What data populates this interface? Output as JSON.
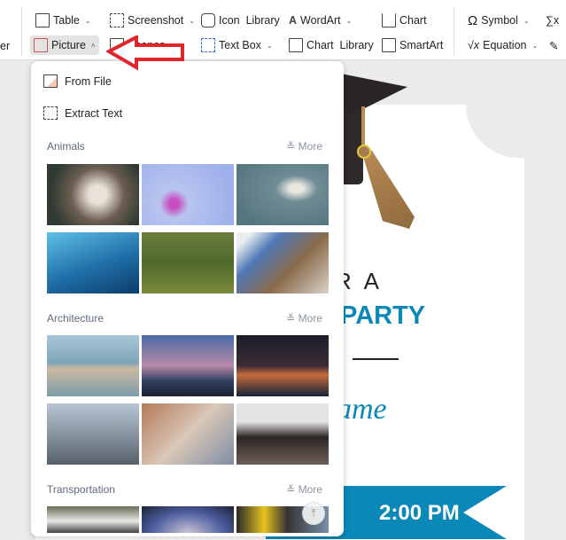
{
  "ribbon": {
    "left_cut": "er",
    "row1": [
      {
        "label": "Table",
        "icon": "table-icon"
      },
      {
        "label": "Screenshot",
        "icon": "screenshot-icon"
      },
      {
        "label": "Icon  Library",
        "icon": "icon-library-icon"
      },
      {
        "label": "WordArt",
        "icon": "wordart-icon"
      },
      {
        "label": "Chart",
        "icon": "chart-icon"
      },
      {
        "label": "Symbol",
        "icon": "omega-icon"
      }
    ],
    "row2": [
      {
        "label": "Picture",
        "icon": "picture-icon"
      },
      {
        "label": "Shapes",
        "icon": "shapes-icon"
      },
      {
        "label": "Text Box",
        "icon": "textbox-icon"
      },
      {
        "label": "Chart  Library",
        "icon": "chart-library-icon"
      },
      {
        "label": "SmartArt",
        "icon": "smartart-icon"
      },
      {
        "label": "Equation",
        "icon": "equation-icon"
      }
    ],
    "symbol_glyph": "Ω",
    "equation_glyph": "√x",
    "sigma_glyph": "∑x",
    "accent": "#e0262b"
  },
  "panel": {
    "from_file": "From File",
    "extract_text": "Extract Text",
    "more": "More",
    "more_glyph": "≚",
    "sections": [
      {
        "title": "Animals"
      },
      {
        "title": "Architecture"
      },
      {
        "title": "Transportation"
      }
    ],
    "totop_glyph": "⤒"
  },
  "document": {
    "line1": "R A",
    "line2": "PARTY",
    "name": "ame",
    "time": "2:00 PM",
    "accent": "#0a88b8"
  }
}
